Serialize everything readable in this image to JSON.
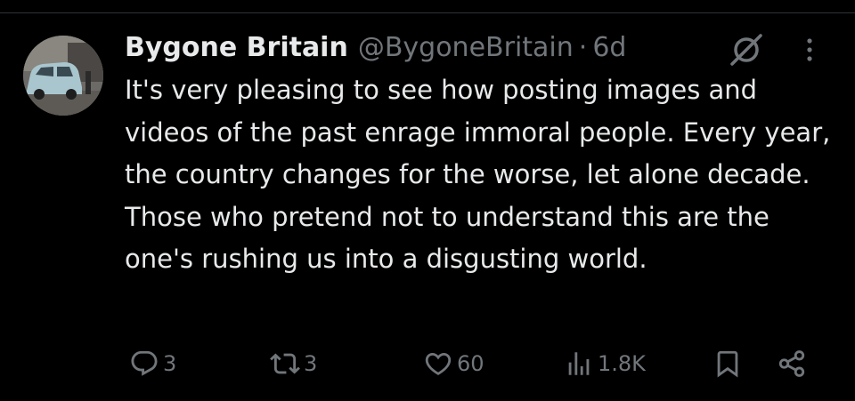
{
  "tweet": {
    "display_name": "Bygone Britain",
    "handle": "@BygoneBritain",
    "separator": "·",
    "time_ago": "6d",
    "text": "It's very pleasing to see how posting images and videos of the past enrage immoral people. Every year, the country changes for the worse, let alone decade. Those who pretend not to understand this are the one's rushing us into a disgusting world.",
    "icons": {
      "avatar": "avatar-vintage-car",
      "grok": "grok-icon",
      "more": "more-vertical-icon"
    }
  },
  "actions": {
    "replies": "3",
    "reposts": "3",
    "likes": "60",
    "views": "1.8K",
    "icons": [
      "reply-icon",
      "repost-icon",
      "like-icon",
      "views-icon",
      "bookmark-icon",
      "share-icon"
    ]
  },
  "colors": {
    "background": "#000000",
    "primary_text": "#e7e9ea",
    "secondary_text": "#71767b",
    "divider": "#2f3336"
  }
}
